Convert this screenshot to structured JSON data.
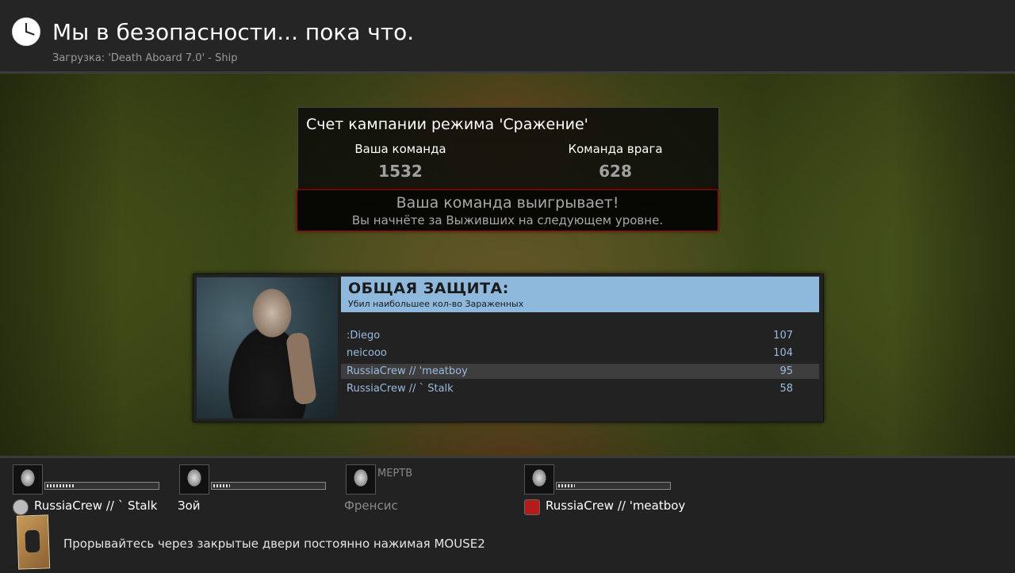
{
  "header": {
    "title": "Мы в безопасности... пока что.",
    "subtitle": "Загрузка: 'Death Aboard 7.0' - Ship"
  },
  "score": {
    "title": "Счет кампании режима 'Сражение'",
    "your_team_label": "Ваша команда",
    "your_team_score": "1532",
    "enemy_team_label": "Команда врага",
    "enemy_team_score": "628",
    "status_line1": "Ваша команда выигрывает!",
    "status_line2": "Вы начнёте за Выживших на следующем уровне."
  },
  "award": {
    "title": "ОБЩАЯ ЗАЩИТА:",
    "subtitle": "Убил наибольшее кол-во Зараженных",
    "rows": [
      {
        "name": ":Diego",
        "value": "107"
      },
      {
        "name": "neicooo",
        "value": "104"
      },
      {
        "name": "RussiaCrew // 'meatboy",
        "value": "95"
      },
      {
        "name": "RussiaCrew // ` Stalk",
        "value": "58"
      }
    ],
    "highlight_row": 2
  },
  "players": [
    {
      "name": "RussiaCrew // ` Stalk",
      "status": "",
      "health": 0.25
    },
    {
      "name": "Зой",
      "status": "",
      "health": 0.15
    },
    {
      "name": "Френсис",
      "status": "МЕРТВ",
      "health": 0
    },
    {
      "name": "RussiaCrew // 'meatboy",
      "status": "",
      "health": 0.15
    }
  ],
  "tip": "Прорывайтесь через закрытые двери  постоянно нажимая MOUSE2",
  "colors": {
    "award_header": "#8fb8dd",
    "award_text": "#9bbbe0",
    "win_border": "#8a1010"
  }
}
